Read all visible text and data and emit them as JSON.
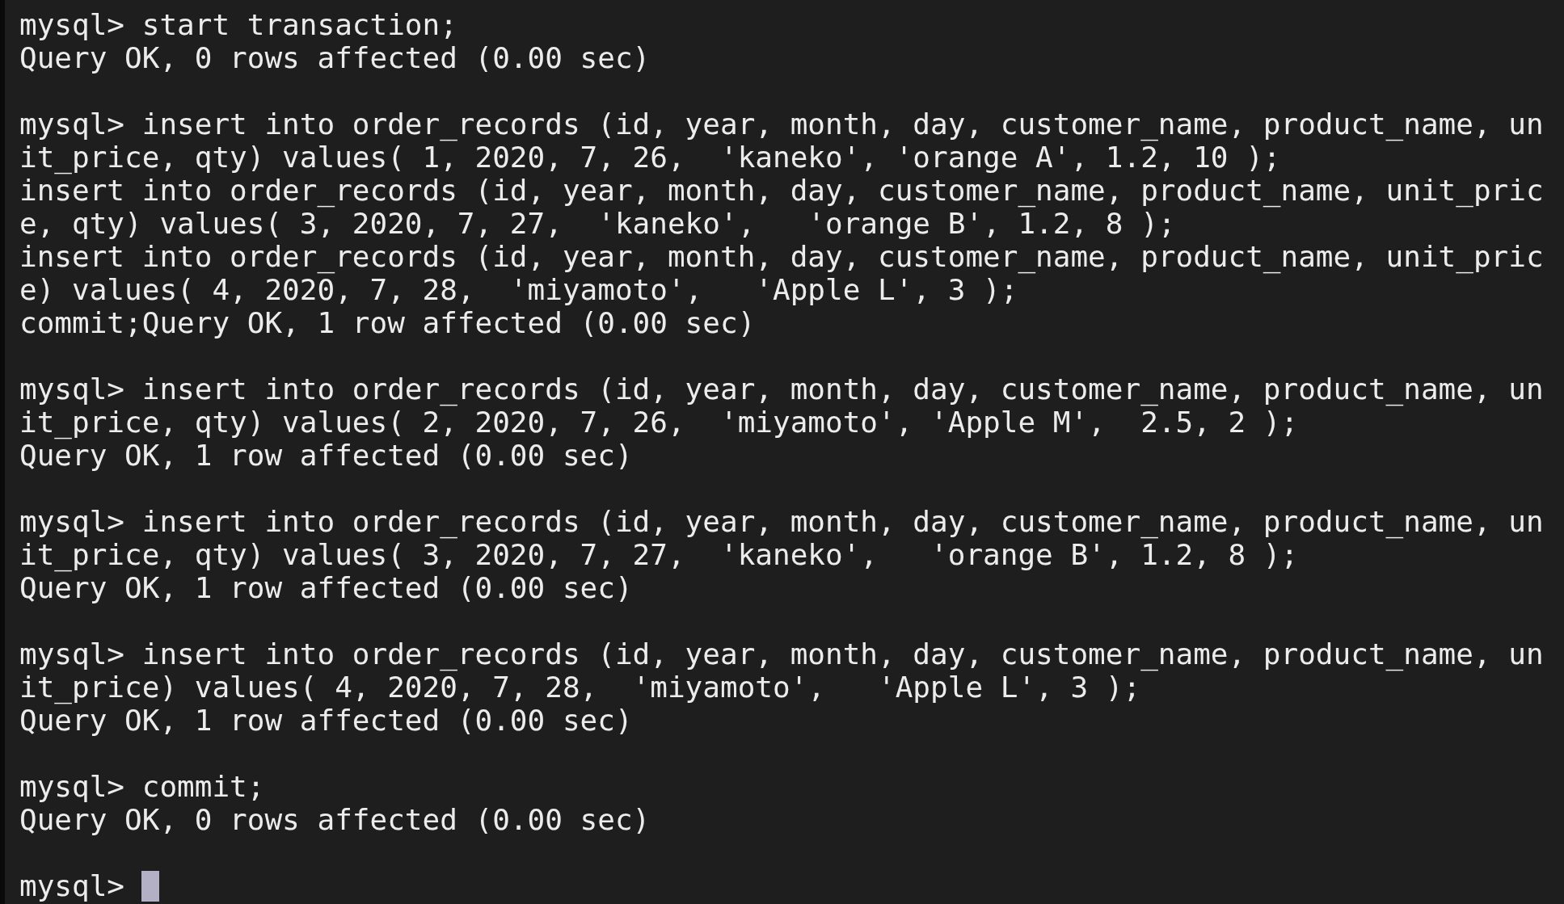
{
  "blocks": [
    {
      "lines": [
        "mysql> start transaction;",
        "Query OK, 0 rows affected (0.00 sec)"
      ]
    },
    {
      "lines": [
        "mysql> insert into order_records (id, year, month, day, customer_name, product_name, un",
        "it_price, qty) values( 1, 2020, 7, 26,  'kaneko', 'orange A', 1.2, 10 );",
        "insert into order_records (id, year, month, day, customer_name, product_name, unit_pric",
        "e, qty) values( 3, 2020, 7, 27,  'kaneko',   'orange B', 1.2, 8 );",
        "insert into order_records (id, year, month, day, customer_name, product_name, unit_pric",
        "e) values( 4, 2020, 7, 28,  'miyamoto',   'Apple L', 3 );",
        "commit;Query OK, 1 row affected (0.00 sec)"
      ]
    },
    {
      "lines": [
        "mysql> insert into order_records (id, year, month, day, customer_name, product_name, un",
        "it_price, qty) values( 2, 2020, 7, 26,  'miyamoto', 'Apple M',  2.5, 2 );",
        "Query OK, 1 row affected (0.00 sec)"
      ]
    },
    {
      "lines": [
        "mysql> insert into order_records (id, year, month, day, customer_name, product_name, un",
        "it_price, qty) values( 3, 2020, 7, 27,  'kaneko',   'orange B', 1.2, 8 );",
        "Query OK, 1 row affected (0.00 sec)"
      ]
    },
    {
      "lines": [
        "mysql> insert into order_records (id, year, month, day, customer_name, product_name, un",
        "it_price) values( 4, 2020, 7, 28,  'miyamoto',   'Apple L', 3 );",
        "Query OK, 1 row affected (0.00 sec)"
      ]
    },
    {
      "lines": [
        "mysql> commit;",
        "Query OK, 0 rows affected (0.00 sec)"
      ]
    }
  ],
  "prompt": {
    "text": "mysql>",
    "cursor": true
  }
}
